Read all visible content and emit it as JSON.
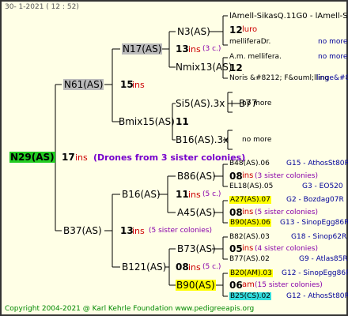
{
  "header": "30-   1-2021  ( 12 : 52)",
  "footer": "Copyright 2004-2021 @ Karl Kehrle Foundation      www.pedigreeapis.org",
  "root": {
    "label": "N29(AS)",
    "num": "17",
    "ins": "ins",
    "drones": "(Drones from 3 sister colonies)"
  },
  "gen1": {
    "top": {
      "label": "N61(AS)",
      "num": "15",
      "ins": "ins"
    },
    "bottom": {
      "label": "B37(AS)",
      "num": "13",
      "ins": "ins",
      "note": "(5 sister colonies)"
    }
  },
  "gen2": {
    "a": {
      "label": "N17(AS)",
      "num": "13",
      "ins": "ins",
      "note": "(3 c.)"
    },
    "b": {
      "label": "Bmix15(AS)",
      "num": "11"
    },
    "c": {
      "label": "B16(AS)",
      "num": "11",
      "ins": "ins",
      "note": "(5 c.)"
    },
    "d": {
      "label": "B121(AS)",
      "num": "08",
      "ins": "ins",
      "note": "(5 c.)"
    }
  },
  "gen3": {
    "n3": {
      "label": "N3(AS)"
    },
    "nmix13": {
      "label": "Nmix13(AS)"
    },
    "si5": {
      "label": "Si5(AS).3x + B77"
    },
    "b16": {
      "label": "B16(AS).3x"
    },
    "b86": {
      "label": "B86(AS)"
    },
    "a45": {
      "label": "A45(AS)"
    },
    "b73": {
      "label": "B73(AS)"
    },
    "b90": {
      "label": "B90(AS)"
    }
  },
  "gen4": {
    "r1": {
      "text": "lAmell-SikasQ.11G0  -  lAmell-Sika"
    },
    "r2": {
      "num": "12",
      "ins": "luro"
    },
    "r3": {
      "text": "melliferaDr.",
      "loc": "no more"
    },
    "r4": {
      "text": "A.m. mellifera.",
      "loc": "no more"
    },
    "r5": {
      "num": "12"
    },
    "r6": {
      "text": "Noris &#8212; F&ouml;lling",
      "loc": "linge&#8!"
    },
    "r7": {
      "text": "no more"
    },
    "r8": {
      "text": "no more"
    },
    "r9": {
      "text": "B48(AS).06",
      "loc": "G15 - AthosSt80R"
    },
    "r10": {
      "num": "08",
      "ins": "ins",
      "note": "(3 sister colonies)"
    },
    "r11": {
      "text": "EL18(AS).05",
      "loc": "G3 - EO520"
    },
    "r12": {
      "text": "A27(AS).07",
      "loc": "G2 - Bozdag07R"
    },
    "r13": {
      "num": "08",
      "ins": "ins",
      "note": "(5 sister colonies)"
    },
    "r14": {
      "text": "B90(AS).06",
      "loc": "G13 - SinopEgg86R"
    },
    "r15": {
      "text": "B82(AS).03",
      "loc": "G18 - Sinop62R"
    },
    "r16": {
      "num": "05",
      "ins": "ins",
      "note": "(4 sister colonies)"
    },
    "r17": {
      "text": "B77(AS).02",
      "loc": "G9 - Atlas85R"
    },
    "r18": {
      "text": "B20(AM).03",
      "loc": "G12 - SinopEgg86R"
    },
    "r19": {
      "num": "06",
      "ins": "am",
      "note": "(15 sister colonies)"
    },
    "r20": {
      "text": "B25(CS).02",
      "loc": "G12 - AthosSt80R"
    }
  }
}
